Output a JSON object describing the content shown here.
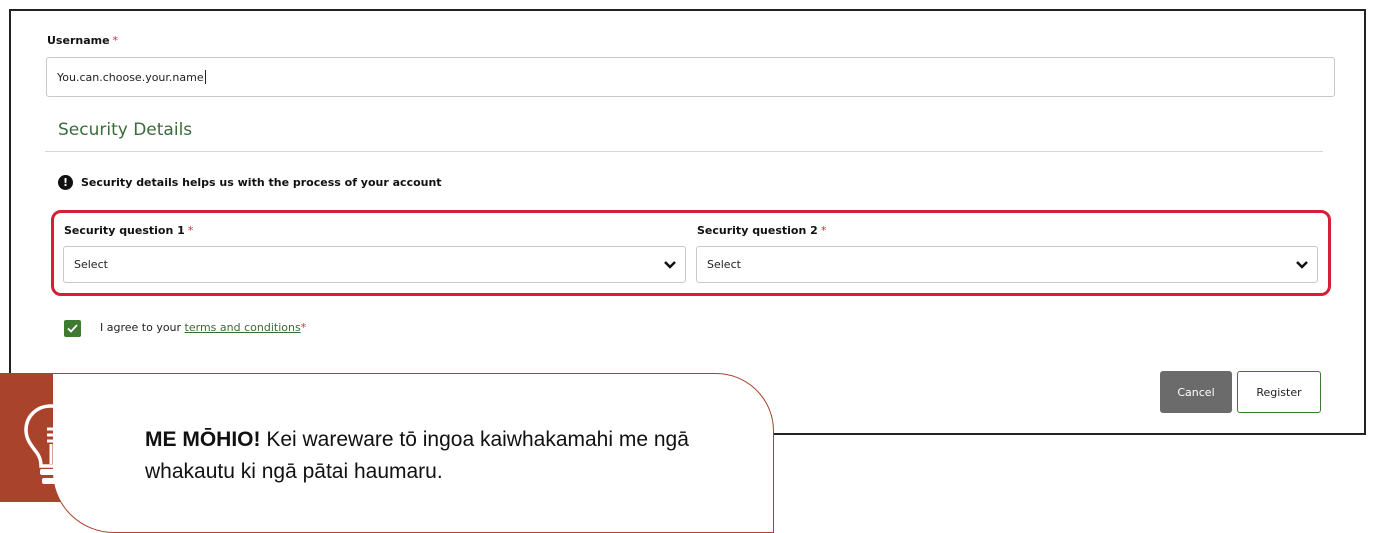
{
  "username": {
    "label": "Username",
    "required_mark": "*",
    "value": "You.can.choose.your.name"
  },
  "security": {
    "title": "Security Details",
    "notice_icon": "exclamation-icon",
    "notice_symbol": "!",
    "notice": "Security details helps us with the process of your account",
    "question1": {
      "label": "Security question 1",
      "required_mark": "*",
      "value": "Select"
    },
    "question2": {
      "label": "Security question 2",
      "required_mark": "*",
      "value": "Select"
    }
  },
  "terms": {
    "checked": true,
    "prefix": "I agree to your ",
    "link": "terms and conditions",
    "required_mark": "*"
  },
  "actions": {
    "cancel": "Cancel",
    "register": "Register"
  },
  "tip": {
    "icon": "lightbulb-icon",
    "heading": "ME MŌHIO!",
    "text": " Kei wareware tō ingoa kaiwhakamahi me ngā whakautu ki ngā pātai haumaru."
  },
  "colors": {
    "accent_green": "#3f7a32",
    "highlight_red": "#d61f36",
    "tip_brown": "#a9432b",
    "cancel_gray": "#6b6b6b"
  }
}
